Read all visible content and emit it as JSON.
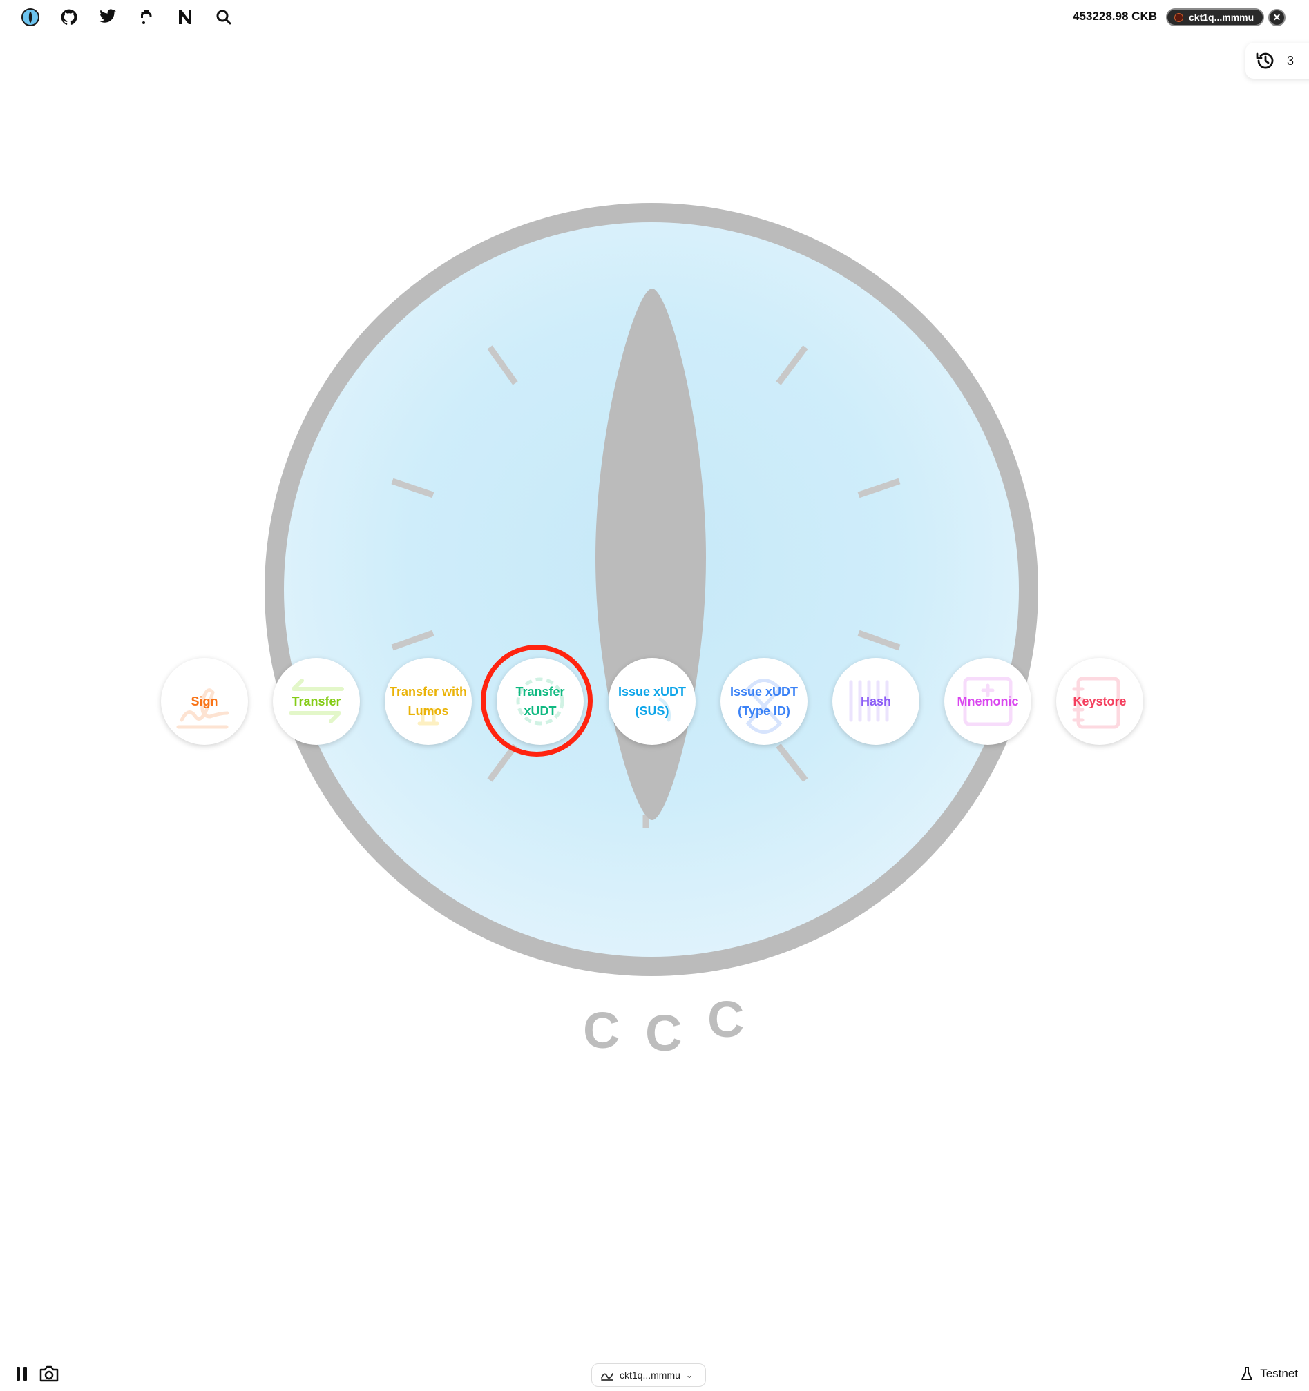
{
  "header": {
    "balance": "453228.98 CKB",
    "address": "ckt1q...mmmu"
  },
  "history": {
    "count": "3"
  },
  "actions": [
    {
      "label": "Sign",
      "color": "#f97316"
    },
    {
      "label": "Transfer",
      "color": "#84cc16"
    },
    {
      "label": "Transfer with Lumos",
      "color": "#eab308"
    },
    {
      "label": "Transfer xUDT",
      "color": "#10b981"
    },
    {
      "label": "Issue xUDT (SUS)",
      "color": "#0ea5e9"
    },
    {
      "label": "Issue xUDT (Type ID)",
      "color": "#3b82f6"
    },
    {
      "label": "Hash",
      "color": "#8b5cf6"
    },
    {
      "label": "Mnemonic",
      "color": "#d946ef"
    },
    {
      "label": "Keystore",
      "color": "#f43f5e"
    }
  ],
  "logo_text": [
    "C",
    "C",
    "C"
  ],
  "footer": {
    "address": "ckt1q...mmmu",
    "network": "Testnet"
  }
}
